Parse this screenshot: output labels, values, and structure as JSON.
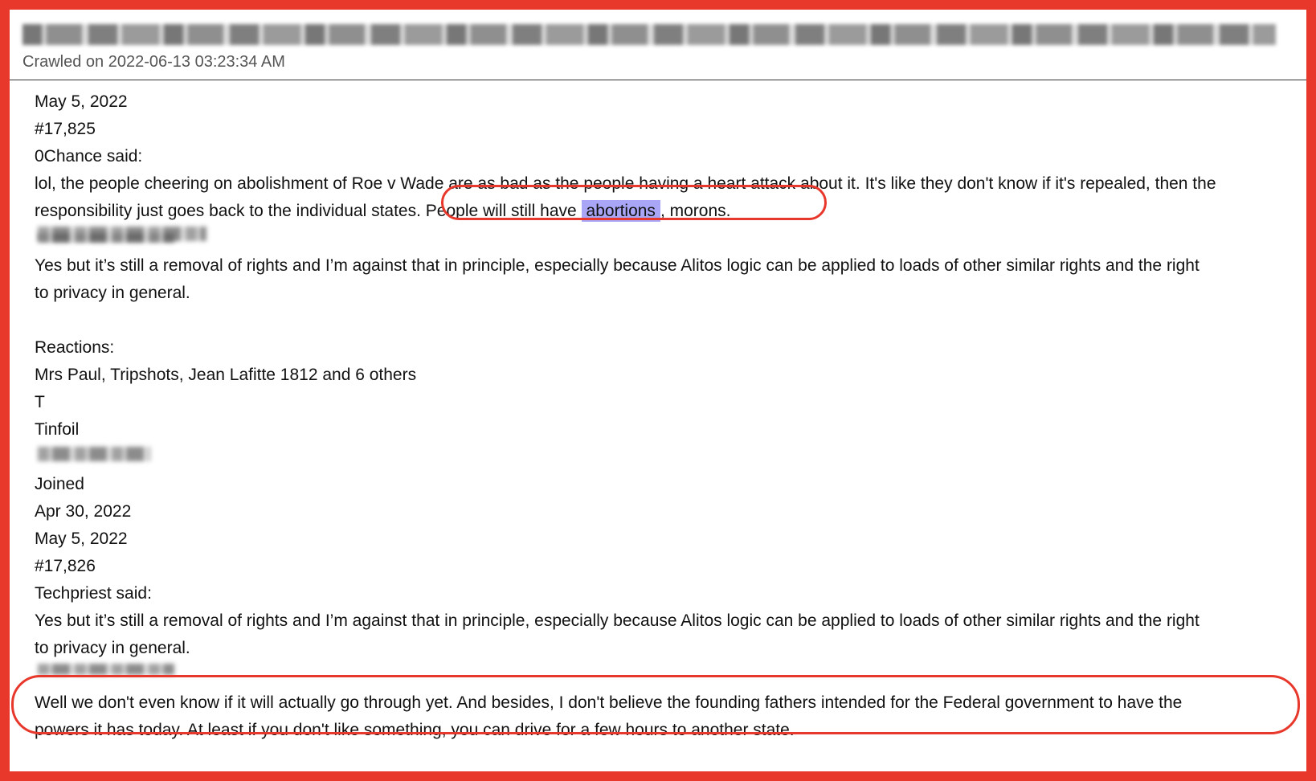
{
  "header": {
    "crawled_text": "Crawled on 2022-06-13 03:23:34 AM"
  },
  "post1": {
    "date": "May 5, 2022",
    "number": "#17,825",
    "quote_author": "0Chance said:",
    "quote_line1": "lol, the people cheering on abolishment of Roe v Wade are as bad as the people having a heart attack about it. It's like they don't know if it's repealed, then the",
    "quote_line2_start": "responsibility just goes back to the individual states",
    "quote_line2_dot": ".",
    "quote_line2_mid": " People will still have ",
    "quote_highlight": "abortions",
    "quote_line2_end": ", morons.",
    "body_line1": "Yes but it’s still a removal of rights and I’m against that in principle, especially because Alitos logic can be applied to loads of other similar rights and the right",
    "body_line2": "to privacy in general.",
    "reactions_label": "Reactions:",
    "reactions_list": "Mrs Paul, Tripshots, Jean Lafitte 1812 and 6 others"
  },
  "post2": {
    "avatar_letter": "T",
    "username": "Tinfoil",
    "joined_label": "Joined",
    "joined_date": "Apr 30, 2022",
    "date": "May 5, 2022",
    "number": "#17,826",
    "quote_author": "Techpriest said:",
    "quote_line1": "Yes but it’s still a removal of rights and I’m against that in principle, especially because Alitos logic can be applied to loads of other similar rights and the right",
    "quote_line2": "to privacy in general.",
    "body_line1": "Well we don't even know if it will actually go through yet. And besides, I don't believe the founding fathers intended for the Federal government to have the",
    "body_line2": "powers it has today. At least if you don't like something, you can drive for a few hours to another state."
  },
  "colors": {
    "frame_border": "#e8382c",
    "highlight": "#a9a6f7",
    "annotation_oval": "#e8382c"
  }
}
